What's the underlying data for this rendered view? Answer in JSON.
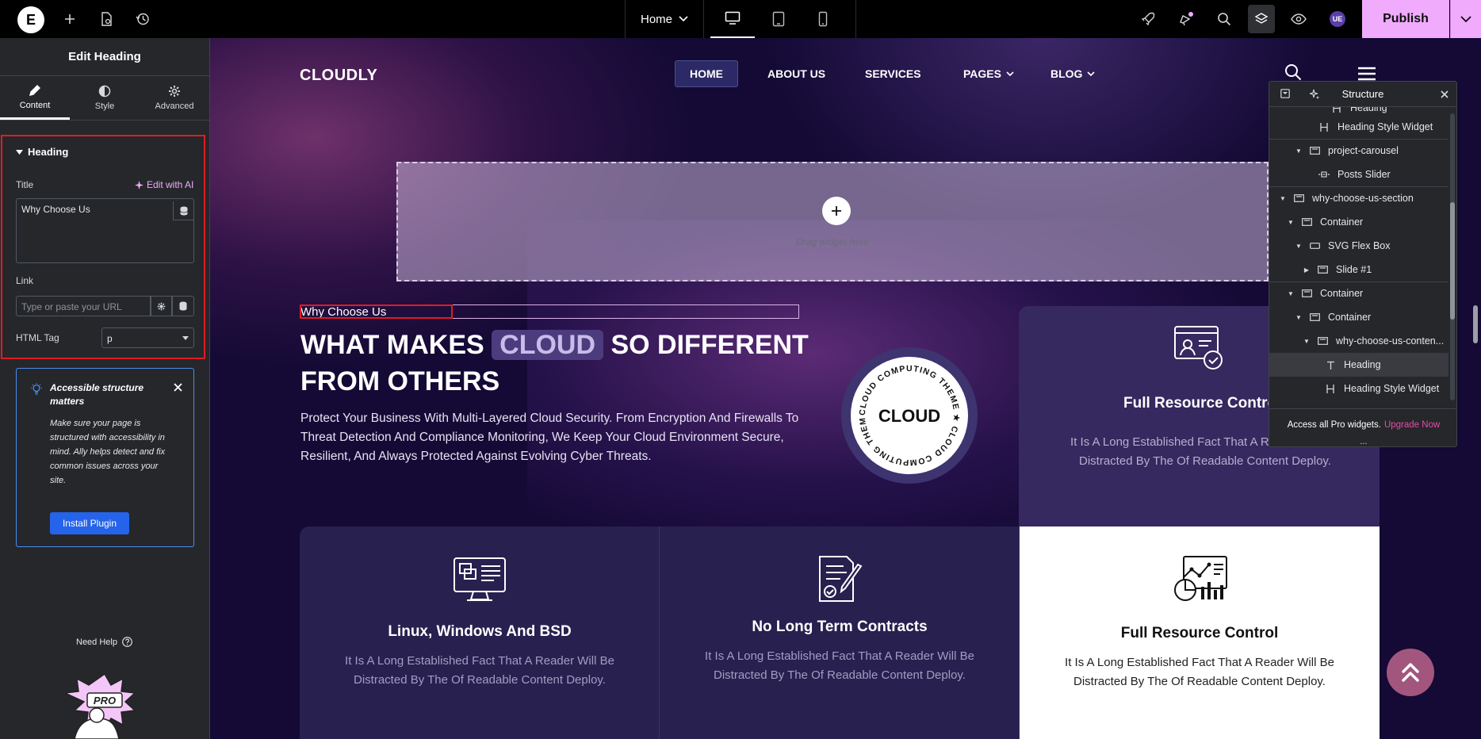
{
  "topbar": {
    "logo_letter": "E",
    "page_name": "Home",
    "publish_label": "Publish",
    "avatar_initials": "UE"
  },
  "panel": {
    "title": "Edit Heading",
    "tabs": [
      {
        "label": "Content",
        "icon": "pencil-icon"
      },
      {
        "label": "Style",
        "icon": "contrast-icon"
      },
      {
        "label": "Advanced",
        "icon": "gear-icon"
      }
    ],
    "section_title": "Heading",
    "title_label": "Title",
    "edit_ai_label": "Edit with AI",
    "title_value": "Why Choose Us",
    "link_label": "Link",
    "link_placeholder": "Type or paste your URL",
    "html_tag_label": "HTML Tag",
    "html_tag_value": "p",
    "notice": {
      "title": "Accessible structure matters",
      "text": "Make sure your page is structured with accessibility in mind. Ally helps detect and fix common issues across your site.",
      "button": "Install Plugin"
    },
    "help_label": "Need Help",
    "pro_label": "PRO"
  },
  "canvas": {
    "nav": {
      "logo": "CLOUDLY",
      "items": [
        "HOME",
        "ABOUT US",
        "SERVICES",
        "PAGES",
        "BLOG"
      ]
    },
    "drop_zone": "Drag widget here",
    "heading_small": "Why Choose Us",
    "heading_big_pre": "WHAT MAKES",
    "heading_big_highlight": "CLOUD",
    "heading_big_post": "SO DIFFERENT",
    "heading_big_line2": "FROM OTHERS",
    "paragraph": "Protect Your Business With Multi-Layered Cloud Security. From Encryption And Firewalls To Threat Detection And Compliance Monitoring, We Keep Your Cloud Environment Secure, Resilient, And Always Protected Against Evolving Cyber Threats.",
    "badge": {
      "center": "CLOUD",
      "ring_text": "CLOUD COMPUTING THEME ★ CLOUD COMPUTING THEME ★"
    },
    "top_card": {
      "title": "Full Resource Control",
      "text": "It Is A Long Established Fact That A Reader Will Be Distracted By The Of Readable Content Deploy."
    },
    "cards": [
      {
        "title": "Linux, Windows And BSD",
        "text": "It Is A Long Established Fact That A Reader Will Be Distracted By The Of Readable Content Deploy.",
        "icon": "monitor-icon"
      },
      {
        "title": "No Long Term Contracts",
        "text": "It Is A Long Established Fact That A Reader Will Be Distracted By The Of Readable Content Deploy.",
        "icon": "contract-icon"
      },
      {
        "title": "Full Resource Control",
        "text": "It Is A Long Established Fact That A Reader Will Be Distracted By The Of Readable Content Deploy.",
        "icon": "analytics-icon"
      }
    ]
  },
  "structure": {
    "title": "Structure",
    "items": [
      {
        "label": "Heading",
        "icon": "heading-icon",
        "level": 3
      },
      {
        "label": "Heading Style Widget",
        "icon": "heading-icon",
        "level": 4
      },
      {
        "label": "project-carousel",
        "icon": "container-icon",
        "level": 2,
        "caret": true
      },
      {
        "label": "Posts Slider",
        "icon": "slider-icon",
        "level": 4
      },
      {
        "label": "why-choose-us-section",
        "icon": "container-icon",
        "level": 0,
        "caret": true
      },
      {
        "label": "Container",
        "icon": "container-icon",
        "level": 1,
        "caret": true
      },
      {
        "label": "SVG Flex Box",
        "icon": "flexbox-icon",
        "level": 2,
        "caret": true
      },
      {
        "label": "Slide #1",
        "icon": "container-icon",
        "level": 3,
        "caret": true,
        "collapsed": true
      },
      {
        "label": "Container",
        "icon": "container-icon",
        "level": 1,
        "caret": true
      },
      {
        "label": "Container",
        "icon": "container-icon",
        "level": 2,
        "caret": true
      },
      {
        "label": "why-choose-us-conten...",
        "icon": "container-icon",
        "level": 3,
        "caret": true
      },
      {
        "label": "Heading",
        "icon": "text-icon",
        "level": 5,
        "active": true
      },
      {
        "label": "Heading Style Widget",
        "icon": "heading-icon",
        "level": 5
      }
    ],
    "footer_text": "Access all Pro widgets.",
    "footer_link": "Upgrade Now",
    "more": "..."
  }
}
